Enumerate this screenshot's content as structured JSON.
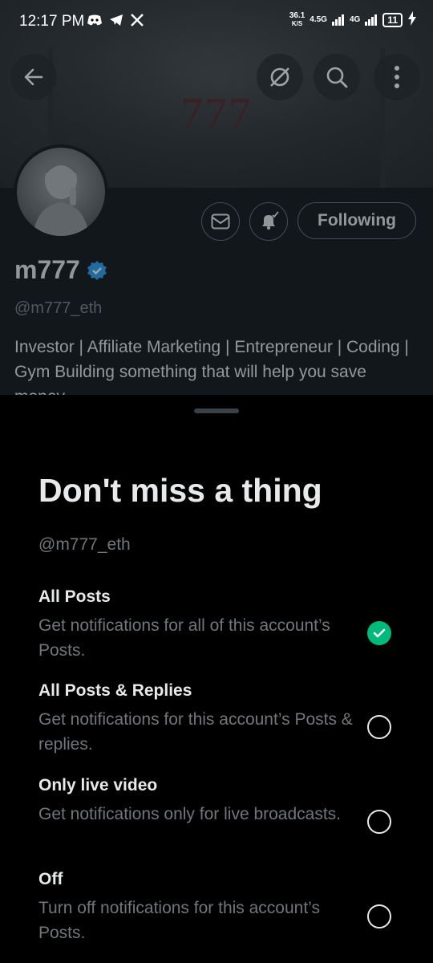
{
  "status_bar": {
    "time": "12:17 PM",
    "net_speed": "36.1",
    "net_unit": "K/S",
    "network1": "4.5G",
    "network2": "4G",
    "battery": "11"
  },
  "banner": {
    "text": "777"
  },
  "profile": {
    "name": "m777",
    "handle": "@m777_eth",
    "bio": "Investor | Affiliate Marketing | Entrepreneur | Coding | Gym Building something that will help you save monev.",
    "following_label": "Following"
  },
  "sheet": {
    "title": "Don't miss a thing",
    "handle": "@m777_eth",
    "options": [
      {
        "title": "All Posts",
        "desc": "Get notifications for all of this account’s Posts.",
        "selected": true
      },
      {
        "title": "All Posts & Replies",
        "desc": "Get notifications for this account’s Posts & replies.",
        "selected": false
      },
      {
        "title": "Only live video",
        "desc": "Get notifications only for live broadcasts.",
        "selected": false
      },
      {
        "title": "Off",
        "desc": "Turn off notifications for this account’s Posts.",
        "selected": false
      }
    ]
  },
  "colors": {
    "accent_green": "#00ba7c",
    "verified_blue": "#1d9bf0",
    "muted_text": "#71767b"
  }
}
